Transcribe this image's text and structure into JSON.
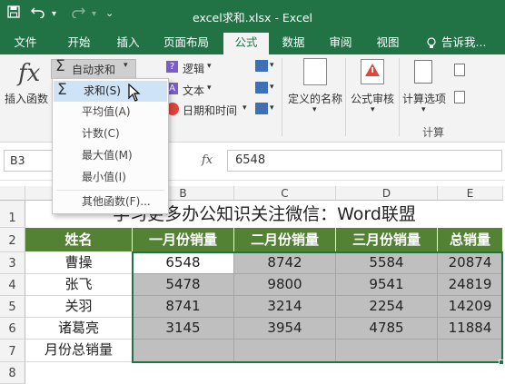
{
  "window": {
    "title": "excel求和.xlsx - Excel",
    "quick_access": {
      "save_icon": "save-icon",
      "undo_icon": "undo-icon",
      "redo_icon": "redo-icon",
      "customize_icon": "customize-icon"
    }
  },
  "tabs": [
    "文件",
    "开始",
    "插入",
    "页面布局",
    "公式",
    "数据",
    "审阅",
    "视图"
  ],
  "active_tab": "公式",
  "tell_me": "告诉我...",
  "ribbon": {
    "insert_function": "插入函数",
    "autosum": "自动求和",
    "logical": "逻辑",
    "text": "文本",
    "datetime": "日期和时间",
    "defined_names": "定义的名称",
    "formula_auditing": "公式审核",
    "calc_options": "计算选项",
    "calc_group": "计算",
    "colors": {
      "autosum_icon": "#444444",
      "red_clock": "#e0443a",
      "blue_book": "#3f6fb5"
    }
  },
  "autosum_menu": [
    "求和(S)",
    "平均值(A)",
    "计数(C)",
    "最大值(M)",
    "最小值(I)",
    "其他函数(F)..."
  ],
  "formula_bar": {
    "name_box": "B3",
    "fx": "fx",
    "content": "6548"
  },
  "sheet": {
    "columns": [
      "B",
      "C",
      "D",
      "E"
    ],
    "row_numbers": [
      "1",
      "2",
      "3",
      "4",
      "5",
      "6",
      "7",
      "8"
    ],
    "title": "学习更多办公知识关注微信：Word联盟",
    "headers": [
      "姓名",
      "一月份销量",
      "二月份销量",
      "三月份销量",
      "总销量"
    ],
    "rows": [
      [
        "曹操",
        "6548",
        "8742",
        "5584",
        "20874"
      ],
      [
        "张飞",
        "5478",
        "9800",
        "9541",
        "24819"
      ],
      [
        "关羽",
        "8741",
        "3214",
        "2254",
        "14209"
      ],
      [
        "诸葛亮",
        "3145",
        "3954",
        "4785",
        "11884"
      ],
      [
        "月份总销量",
        "",
        "",
        "",
        ""
      ]
    ],
    "colors": {
      "header_fill": "#548235",
      "selection_fill": "#bfbfbf",
      "accent": "#217346"
    }
  }
}
